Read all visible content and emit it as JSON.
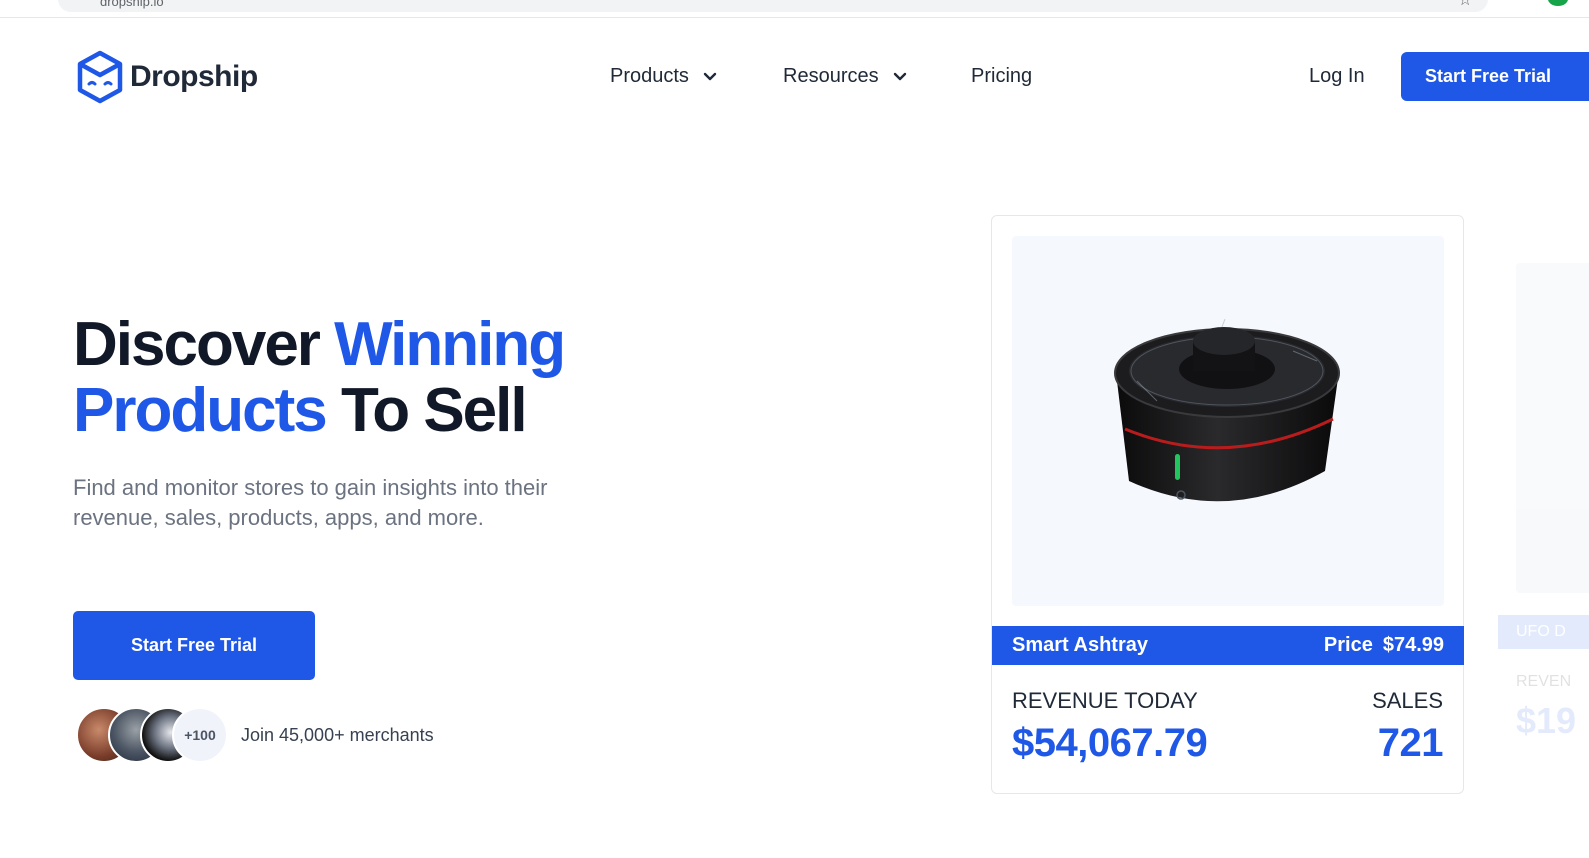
{
  "browser": {
    "url": "dropship.io"
  },
  "brand": {
    "name": "Dropship",
    "logo_icon": "box-face-icon",
    "color": "#1f57e7"
  },
  "nav": {
    "items": [
      {
        "label": "Products",
        "has_dropdown": true
      },
      {
        "label": "Resources",
        "has_dropdown": true
      },
      {
        "label": "Pricing",
        "has_dropdown": false
      }
    ],
    "login": "Log In",
    "cta": "Start Free Trial"
  },
  "hero": {
    "title_part1": "Discover ",
    "title_accent1": "Winning",
    "title_accent2": "Products",
    "title_part2": " To Sell",
    "subtitle": "Find and monitor stores to gain insights into their revenue, sales, products, apps, and more.",
    "cta": "Start Free Trial",
    "avatars_more": "+100",
    "join_text": "Join 45,000+ merchants"
  },
  "product_card": {
    "name": "Smart Ashtray",
    "price_label": "Price",
    "price": "$74.99",
    "revenue_label": "REVENUE TODAY",
    "revenue_value": "$54,067.79",
    "sales_label": "SALES",
    "sales_value": "721"
  },
  "ghost_card": {
    "name": "UFO D",
    "label": "REVEN",
    "value": "$19"
  },
  "colors": {
    "accent": "#1f57e7",
    "text_dark": "#111827",
    "text_muted": "#6b7280"
  }
}
